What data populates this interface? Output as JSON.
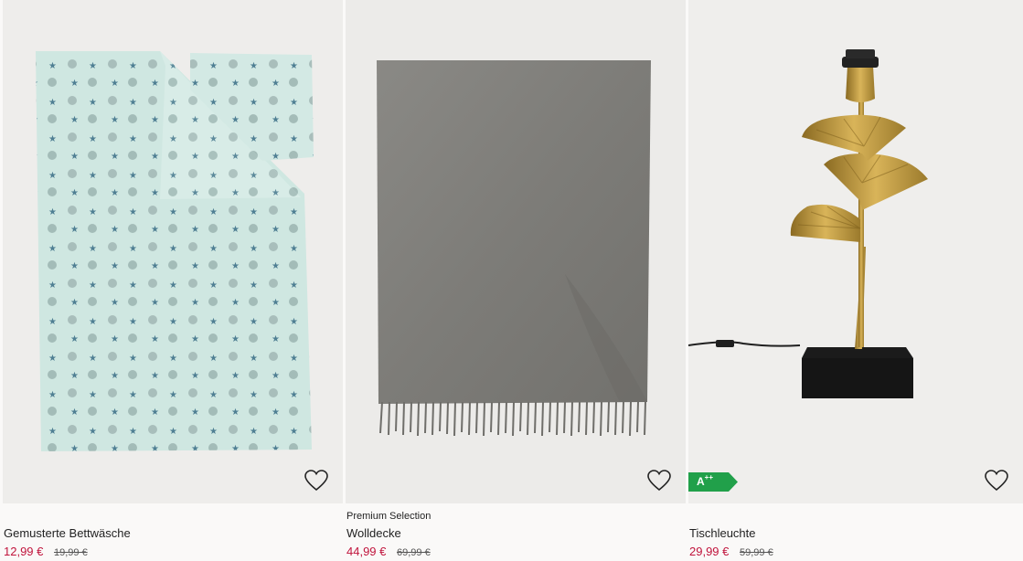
{
  "products": [
    {
      "subtitle": "",
      "name": "Gemusterte Bettwäsche",
      "price": "12,99 €",
      "old_price": "19,99 €"
    },
    {
      "subtitle": "Premium Selection",
      "name": "Wolldecke",
      "price": "44,99 €",
      "old_price": "69,99 €"
    },
    {
      "subtitle": "",
      "name": "Tischleuchte",
      "price": "29,99 €",
      "old_price": "59,99 €",
      "energy_label": "A",
      "energy_label_sup": "++"
    }
  ],
  "colors": {
    "sale_price": "#c0143c",
    "energy_badge": "#21a04a"
  },
  "icons": {
    "favorite": "heart-outline-icon"
  }
}
